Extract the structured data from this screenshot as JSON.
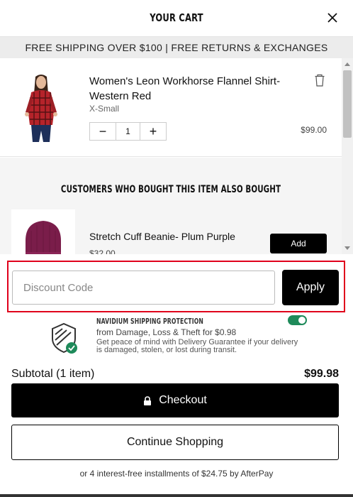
{
  "header": {
    "title": "YOUR CART",
    "close_icon": "close-icon"
  },
  "banner": {
    "text": "FREE SHIPPING OVER $100 | FREE RETURNS & EXCHANGES"
  },
  "cart_item": {
    "name": "Women's Leon Workhorse Flannel Shirt- Western Red",
    "variant": "X-Small",
    "quantity": "1",
    "minus_label": "−",
    "plus_label": "+",
    "price": "$99.00",
    "remove_icon": "trash-icon",
    "image_icon": "flannel-shirt-image"
  },
  "upsell": {
    "title": "CUSTOMERS WHO BOUGHT THIS ITEM ALSO BOUGHT",
    "name": "Stretch Cuff Beanie- Plum Purple",
    "price": "$32.00",
    "add_label": "Add",
    "image_icon": "beanie-image"
  },
  "discount": {
    "placeholder": "Discount Code",
    "value": "",
    "apply_label": "Apply",
    "highlight_color": "#e0001b"
  },
  "protection": {
    "title": "NAVIDIUM SHIPPING PROTECTION",
    "price_text": "from Damage, Loss & Theft for $0.98",
    "description": "Get peace of mind with Delivery Guarantee if your delivery is damaged, stolen, or lost during transit.",
    "enabled": true,
    "toggle_color": "#1e8a5a",
    "icon": "shield-check-icon"
  },
  "summary": {
    "subtotal_label": "Subtotal (1 item)",
    "subtotal_value": "$99.98"
  },
  "actions": {
    "checkout_label": "Checkout",
    "checkout_icon": "lock-icon",
    "continue_label": "Continue Shopping"
  },
  "afterpay": {
    "text": "or 4 interest-free installments of $24.75 by AfterPay"
  }
}
